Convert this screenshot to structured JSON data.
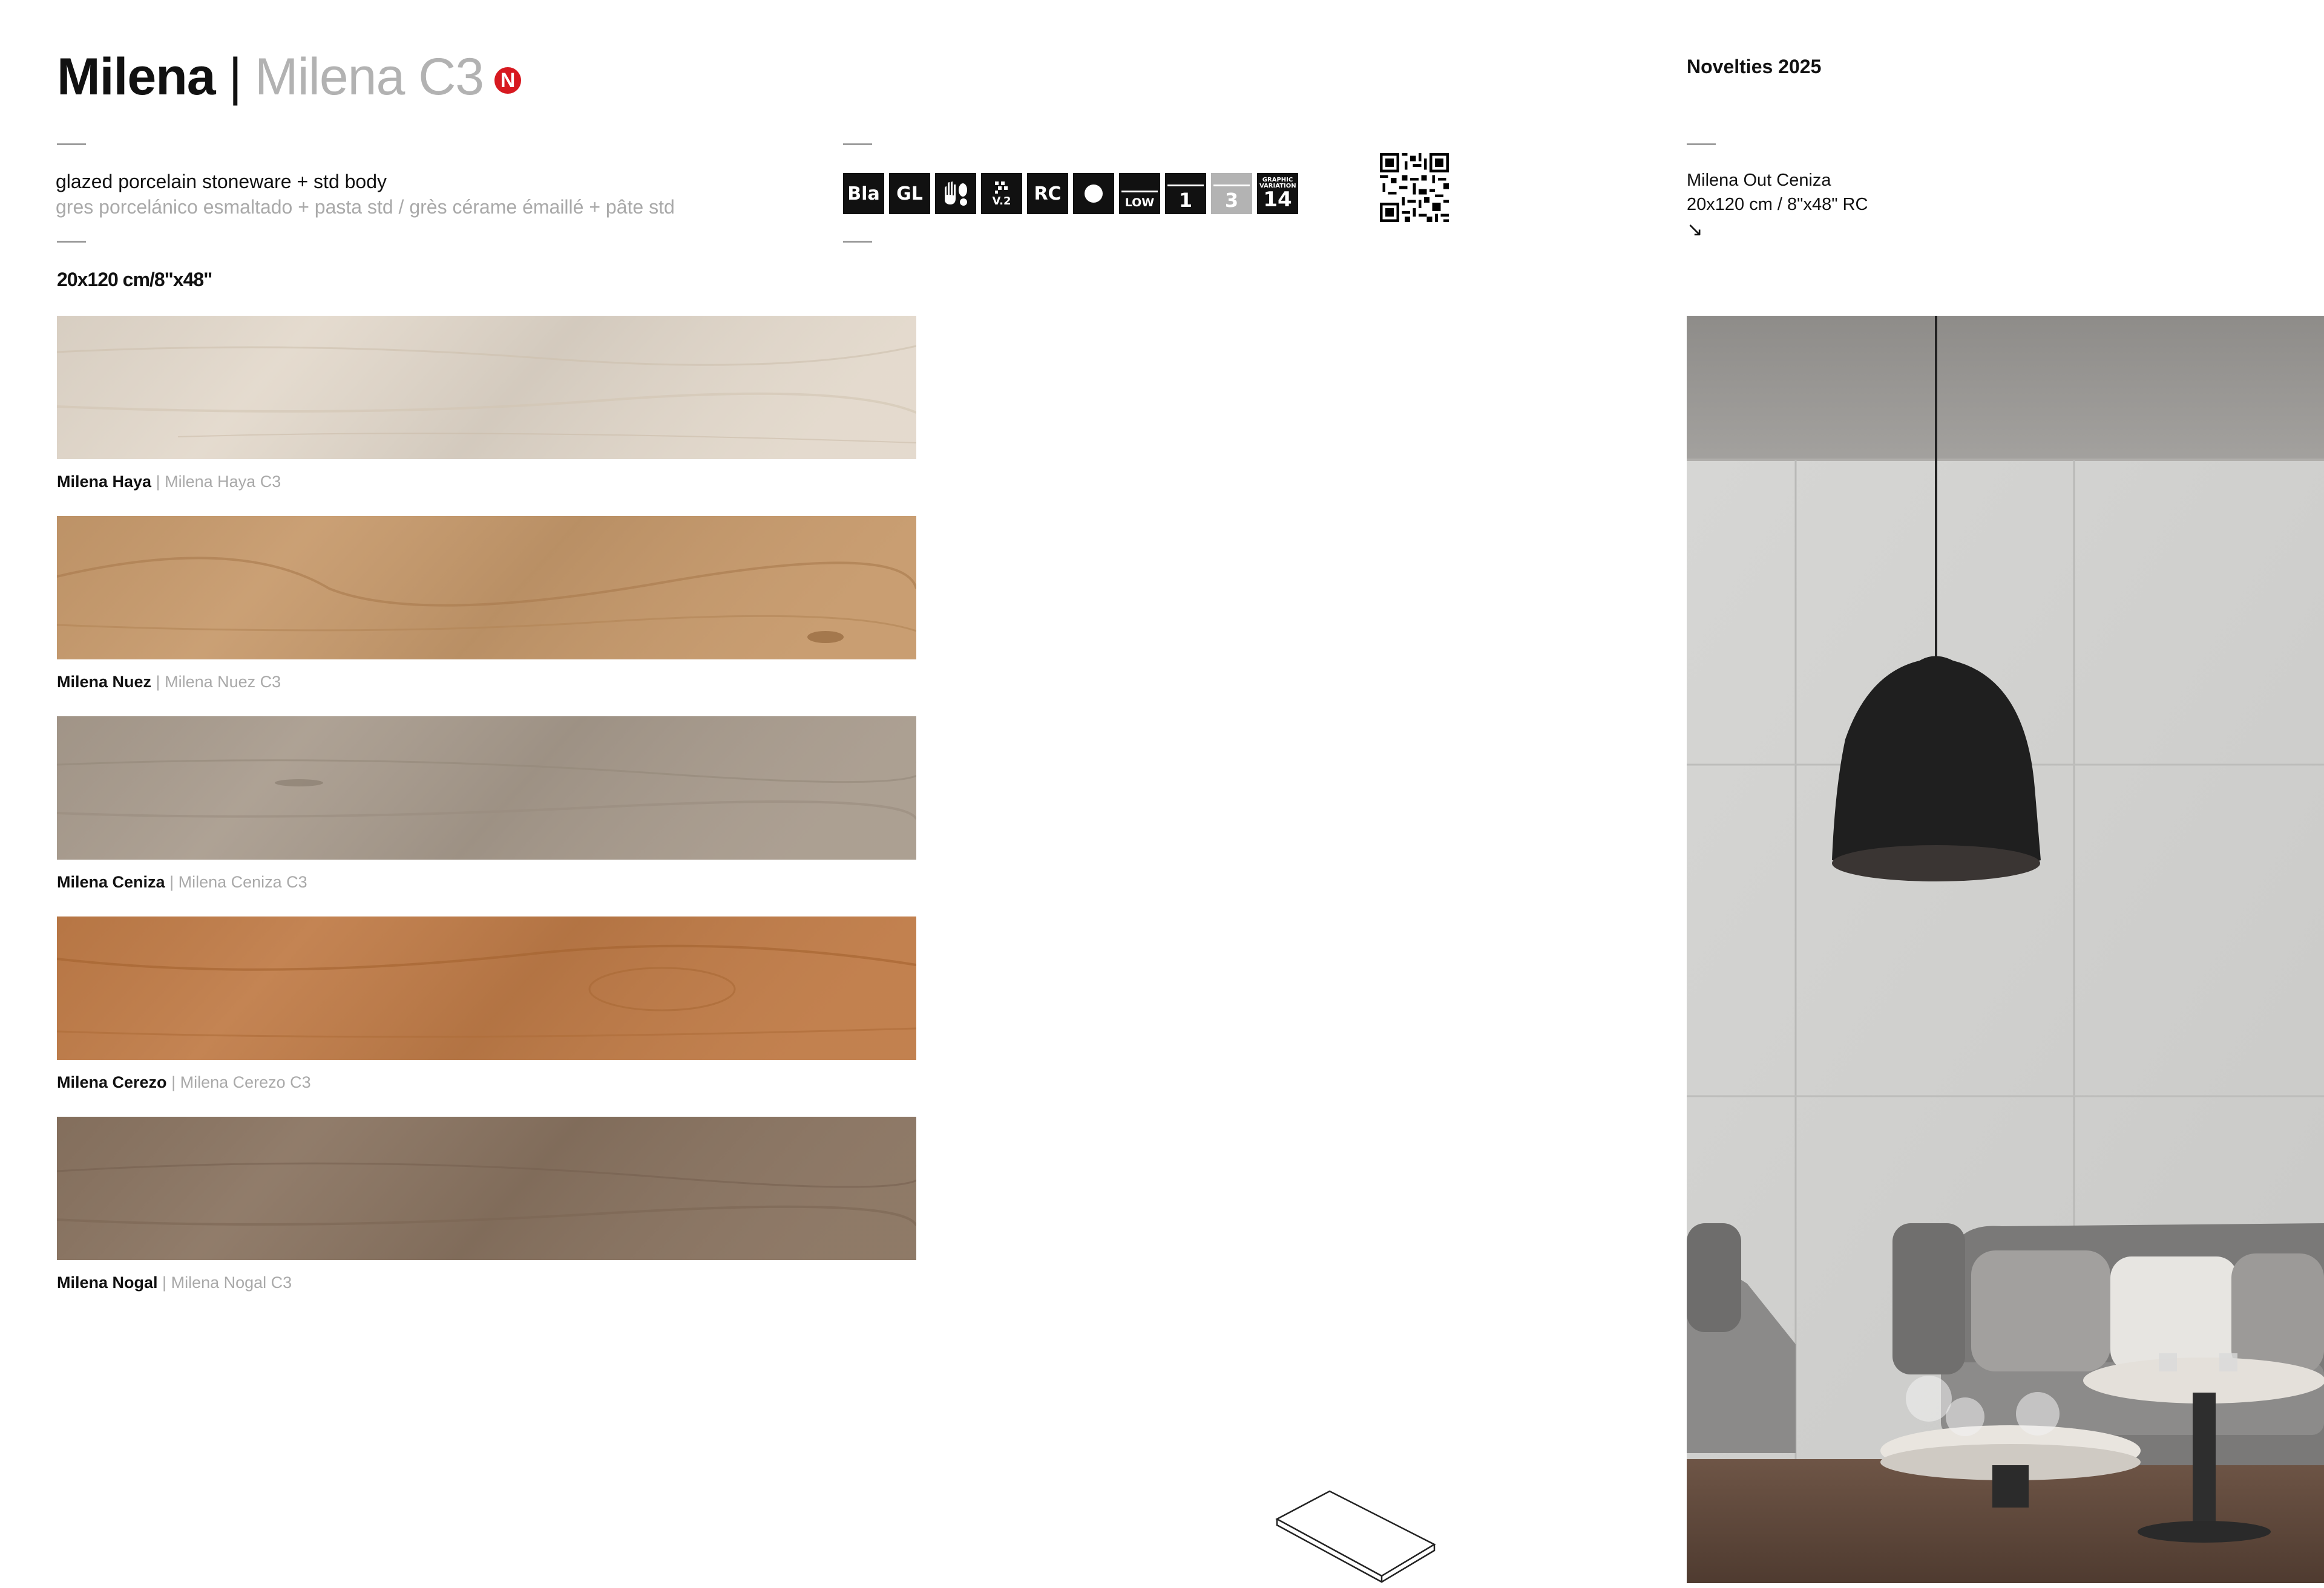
{
  "header": {
    "title_main": "Milena",
    "title_sep": "|",
    "title_sub": "Milena C3",
    "novelty_badge": "N",
    "novelties": "Novelties 2025"
  },
  "description": {
    "en": "glazed porcelain stoneware + std body",
    "translations": "gres porcelánico esmaltado + pasta std / grès cérame émaillé + pâte std"
  },
  "format": "20x120 cm/8\"x48\"",
  "tech_icons": [
    {
      "name": "bla-icon",
      "label": "Bla"
    },
    {
      "name": "gl-icon",
      "label": "GL"
    },
    {
      "name": "hand-foot-icon",
      "label": ""
    },
    {
      "name": "variation-v2-icon",
      "label": "V.2"
    },
    {
      "name": "rc-icon",
      "label": "RC"
    },
    {
      "name": "dot-icon",
      "label": ""
    },
    {
      "name": "low-icon",
      "label": "LOW"
    },
    {
      "name": "slip-1-icon",
      "label": "1"
    },
    {
      "name": "slip-3-icon",
      "label": "3"
    },
    {
      "name": "graphic-variation-icon",
      "label": "GRAPHIC VARIATION",
      "number": "14"
    }
  ],
  "tiles": [
    {
      "name": "Milena Haya",
      "alt": "Milena Haya C3",
      "color": "#e3d9cc"
    },
    {
      "name": "Milena Nuez",
      "alt": "Milena Nuez C3",
      "color": "#c79a6c"
    },
    {
      "name": "Milena Ceniza",
      "alt": "Milena Ceniza C3",
      "color": "#a99c8e"
    },
    {
      "name": "Milena Cerezo",
      "alt": "Milena Cerezo C3",
      "color": "#c07c48"
    },
    {
      "name": "Milena Nogal",
      "alt": "Milena Nogal C3",
      "color": "#8a7461"
    }
  ],
  "ambient": {
    "caption_name": "Milena Out Ceniza",
    "caption_size": "20x120 cm / 8\"x48\" RC",
    "arrow": "↘"
  }
}
